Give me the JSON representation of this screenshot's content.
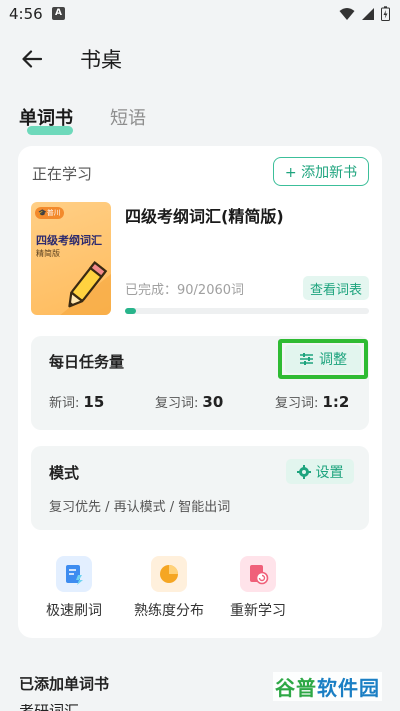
{
  "status_bar": {
    "time": "4:56",
    "notif_letter": "A"
  },
  "app_bar": {
    "title": "书桌"
  },
  "tabs": [
    {
      "label": "单词书",
      "active": true
    },
    {
      "label": "短语",
      "active": false
    }
  ],
  "current_book": {
    "section_label": "正在学习",
    "add_button_label": "+ 添加新书",
    "cover_badge": "🎓普川",
    "cover_title": "四级考纲词汇",
    "cover_subtitle": "精简版",
    "name": "四级考纲词汇(精简版)",
    "progress_text": "已完成：90/2060词",
    "progress_fraction": 0.0437,
    "word_list_button": "查看词表"
  },
  "daily_task": {
    "title": "每日任务量",
    "adjust_button": "调整",
    "new_label": "新词:",
    "new_value": "15",
    "review_label": "复习词:",
    "review_value": "30",
    "ratio_label": "复习词:",
    "ratio_value": "1:2"
  },
  "mode": {
    "title": "模式",
    "settings_button": "设置",
    "description": "复习优先 / 再认模式 / 智能出词"
  },
  "quick_actions": [
    {
      "label": "极速刷词",
      "icon": "flash-card-icon",
      "color": "#3d8cf0"
    },
    {
      "label": "熟练度分布",
      "icon": "pie-chart-icon",
      "color": "#f5a623"
    },
    {
      "label": "重新学习",
      "icon": "restart-icon",
      "color": "#f0607a"
    }
  ],
  "added_books": {
    "title": "已添加单词书",
    "first_item_partial": "考研词汇"
  },
  "watermark": {
    "part1": "谷普",
    "part2": "软件园"
  },
  "colors": {
    "accent": "#1ea47e",
    "highlight_box": "#2fbb33",
    "background": "#f2f4f5"
  }
}
